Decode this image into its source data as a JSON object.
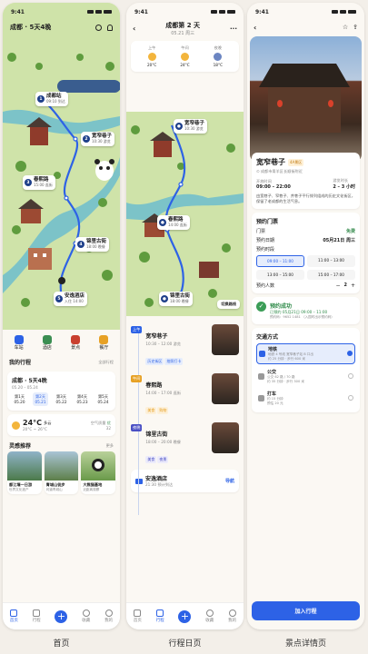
{
  "status_time": "9:41",
  "captions": {
    "home": "首页",
    "day": "行程日页",
    "detail": "景点详情页"
  },
  "home": {
    "city": "成都 · 5天4晚",
    "pins": [
      {
        "num": "1",
        "name": "成都站",
        "sub": "09:10 到达"
      },
      {
        "num": "2",
        "name": "宽窄巷子",
        "sub": "10:30 游览"
      },
      {
        "num": "3",
        "name": "春熙路",
        "sub": "15:00 逛街"
      },
      {
        "num": "4",
        "name": "锦里古街",
        "sub": "18:00 晚餐"
      },
      {
        "num": "5",
        "name": "安逸酒店",
        "sub": "入住 14:00"
      }
    ],
    "quick": [
      {
        "label": "车站",
        "icon": "train-icon"
      },
      {
        "label": "酒店",
        "icon": "hotel-icon"
      },
      {
        "label": "景点",
        "icon": "attraction-icon"
      },
      {
        "label": "餐厅",
        "icon": "restaurant-icon"
      }
    ],
    "trip_section": "我的行程",
    "trip_all": "全部行程",
    "trip_title": "成都 · 5天4晚",
    "trip_range": "05.20 – 05.24",
    "days": [
      {
        "d": "第1天",
        "date": "05.20"
      },
      {
        "d": "第2天",
        "date": "05.21"
      },
      {
        "d": "第3天",
        "date": "05.22"
      },
      {
        "d": "第4天",
        "date": "05.23"
      },
      {
        "d": "第5天",
        "date": "05.24"
      }
    ],
    "weather": {
      "temp": "24°C",
      "desc": "多云",
      "range": "20°C ~ 26°C",
      "aq_label": "空气质量",
      "aq_level": "优",
      "aq_value": "32"
    },
    "insp": {
      "title": "灵感推荐",
      "more": "更多",
      "items": [
        {
          "name": "都江堰一日游",
          "sub": "世界文化遗产"
        },
        {
          "name": "青城山徒步",
          "sub": "问道青城山"
        },
        {
          "name": "大熊猫基地",
          "sub": "近距离观察"
        }
      ]
    },
    "tabs": [
      "首页",
      "行程",
      "",
      "收藏",
      "我的"
    ]
  },
  "day": {
    "title": "成都第 2 天",
    "date": "05.21 周三",
    "weather": [
      {
        "period": "上午",
        "temp": "20°C"
      },
      {
        "period": "午间",
        "temp": "24°C"
      },
      {
        "period": "夜晚",
        "temp": "18°C"
      }
    ],
    "pins": [
      {
        "name": "宽窄巷子",
        "sub": "10:30 游览"
      },
      {
        "name": "春熙路",
        "sub": "14:00 逛街"
      },
      {
        "name": "锦里古街",
        "sub": "18:00 晚餐"
      }
    ],
    "switch": "切换路线",
    "items": [
      {
        "period": "上午",
        "name": "宽窄巷子",
        "time": "10:30 – 12:00 游览",
        "tags": [
          "历史街区",
          "拍照打卡"
        ]
      },
      {
        "period": "午间",
        "name": "春熙路",
        "time": "14:00 – 17:00 逛街",
        "tags": [
          "美食",
          "购物"
        ]
      },
      {
        "period": "夜晚",
        "name": "锦里古街",
        "time": "18:00 – 20:00 晚餐",
        "tags": [
          "美食",
          "夜景"
        ]
      }
    ],
    "hotel": {
      "name": "安逸酒店",
      "time": "21:30 预计到达",
      "nav": "导航"
    },
    "tabs": [
      "首页",
      "行程",
      "",
      "收藏",
      "我的"
    ]
  },
  "detail": {
    "name": "宽窄巷子",
    "badge": "4A景区",
    "addr": "成都市青羊区长顺街附近",
    "open_label": "开放时间",
    "open": "09:00 – 22:00",
    "suggest_label": "游览时长",
    "suggest": "2 – 3 小时",
    "desc": "由宽巷子、窄巷子、井巷子平行排列组成的历史文化街区，保留了老成都的生活气息。",
    "ticket_title": "预约门票",
    "ticket_label": "门票",
    "ticket_value": "免费",
    "date_label": "预约日期",
    "date_value": "05月21日 周三",
    "time_label": "预约时段",
    "slots": [
      "09:00 – 11:00",
      "11:00 – 13:00",
      "13:00 – 15:00",
      "15:00 – 17:00"
    ],
    "people_label": "预约人数",
    "people": "2",
    "success_title": "预约成功",
    "success_sub": "已预约 05月21日 09:00 – 11:00",
    "success_code": "预约码：9652 1481  （入园时出示预约码）",
    "transport_title": "交通方式",
    "transport": [
      {
        "name": "地铁",
        "sub": "地铁 4 号线 宽窄巷子站 B 口出",
        "sub2": "约 25 分钟 · 步行 600 米"
      },
      {
        "name": "公交",
        "sub": "公交 62 路 / 70 路",
        "sub2": "约 35 分钟 · 步行 300 米"
      },
      {
        "name": "打车",
        "sub": "约 15 分钟",
        "sub2": "预估 20 元"
      }
    ],
    "cta": "加入行程"
  }
}
